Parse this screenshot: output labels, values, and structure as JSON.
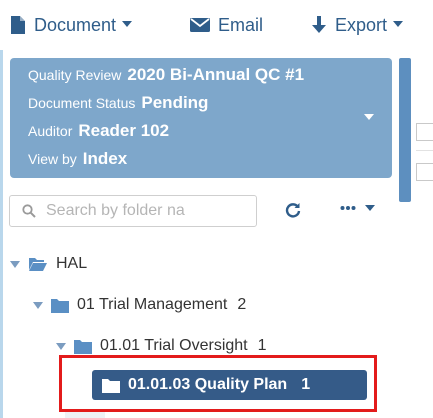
{
  "toolbar": {
    "document_label": "Document",
    "email_label": "Email",
    "export_label": "Export"
  },
  "info": {
    "quality_review_label": "Quality Review",
    "quality_review_value": "2020 Bi-Annual QC #1",
    "status_label": "Document Status",
    "status_value": "Pending",
    "auditor_label": "Auditor",
    "auditor_value": "Reader 102",
    "viewby_label": "View by",
    "viewby_value": "Index"
  },
  "search": {
    "placeholder": "Search by folder na"
  },
  "tree": {
    "root": {
      "label": "HAL"
    },
    "level1": {
      "label": "01 Trial Management",
      "count": "2"
    },
    "level2": {
      "label": "01.01 Trial Oversight",
      "count": "1"
    },
    "level3": {
      "label": "01.01.03 Quality Plan",
      "count": "1"
    }
  },
  "colors": {
    "accent": "#2f5d8a",
    "panel": "#7ea7cb",
    "selected": "#355b88",
    "highlight": "#e31b1b",
    "folder": "#5a8fc4"
  }
}
